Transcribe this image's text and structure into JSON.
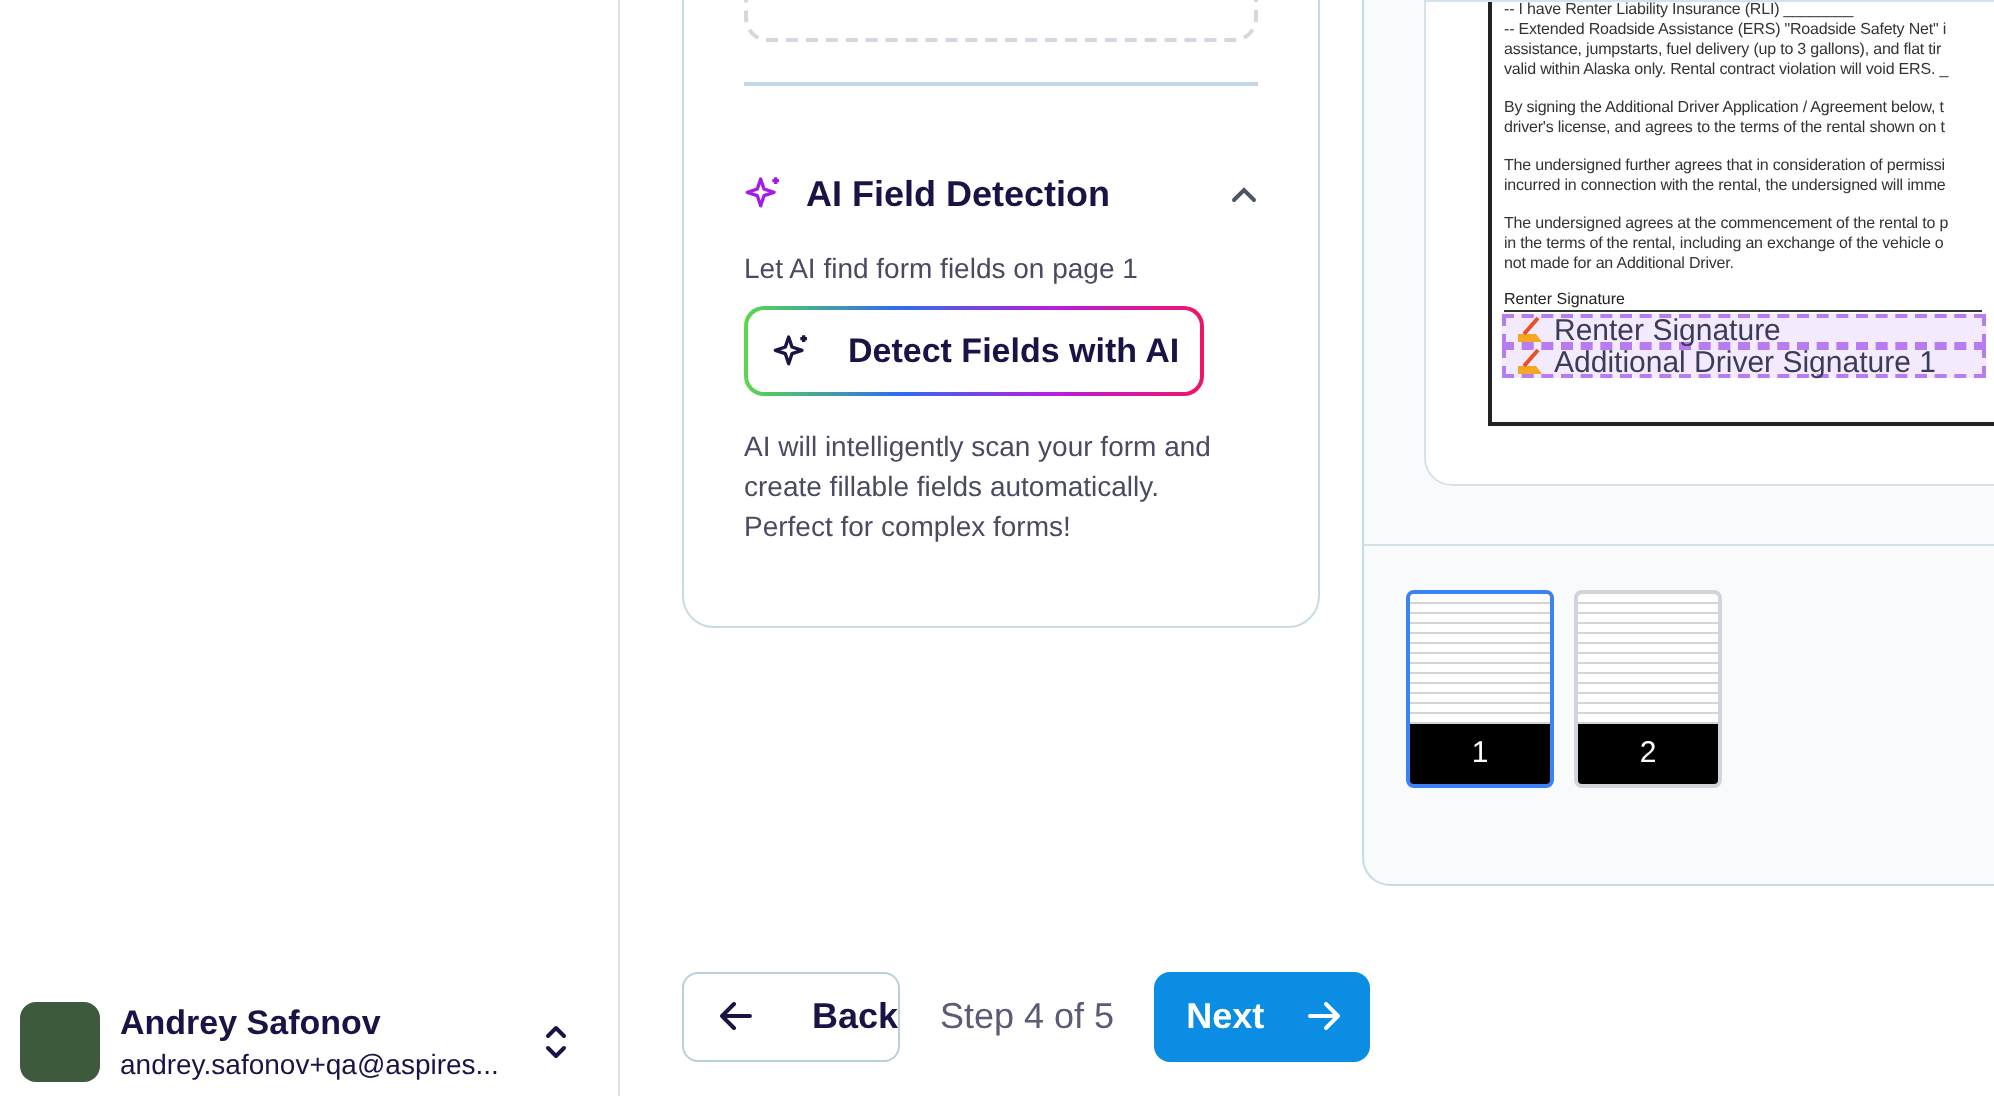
{
  "ai_section": {
    "title": "AI Field Detection",
    "expanded": true,
    "subtitle": "Let AI find form fields on page 1",
    "button": "Detect Fields with AI",
    "description": "AI will intelligently scan your form and create fillable fields automatically. Perfect for complex forms!"
  },
  "document": {
    "paragraphs": [
      [
        "-- I have Renter Liability Insurance (RLI) ________",
        "-- Extended Roadside Assistance (ERS) \"Roadside Safety Net\" i",
        "assistance, jumpstarts, fuel delivery (up to 3 gallons), and flat tir",
        "valid within Alaska only. Rental contract violation will void ERS. _"
      ],
      [
        "By signing the Additional Driver Application / Agreement below, t",
        "driver's license, and agrees to the terms of the rental shown on t"
      ],
      [
        "The undersigned further agrees that in consideration of permissi",
        "incurred in connection with the rental, the undersigned will imme"
      ],
      [
        "The undersigned agrees at the commencement of the rental to p",
        "in the terms of the rental, including an exchange of the vehicle o",
        "not made for an Additional Driver."
      ]
    ],
    "signature_label": "Renter Signature",
    "fields": [
      {
        "label": "Renter Signature"
      },
      {
        "label": "Additional Driver Signature 1"
      }
    ]
  },
  "thumbnails": [
    {
      "label": "1",
      "selected": true
    },
    {
      "label": "2",
      "selected": false
    }
  ],
  "user": {
    "name": "Andrey Safonov",
    "email": "andrey.safonov+qa@aspires..."
  },
  "footer": {
    "back": "Back",
    "step": "Step 4 of 5",
    "next": "Next"
  }
}
